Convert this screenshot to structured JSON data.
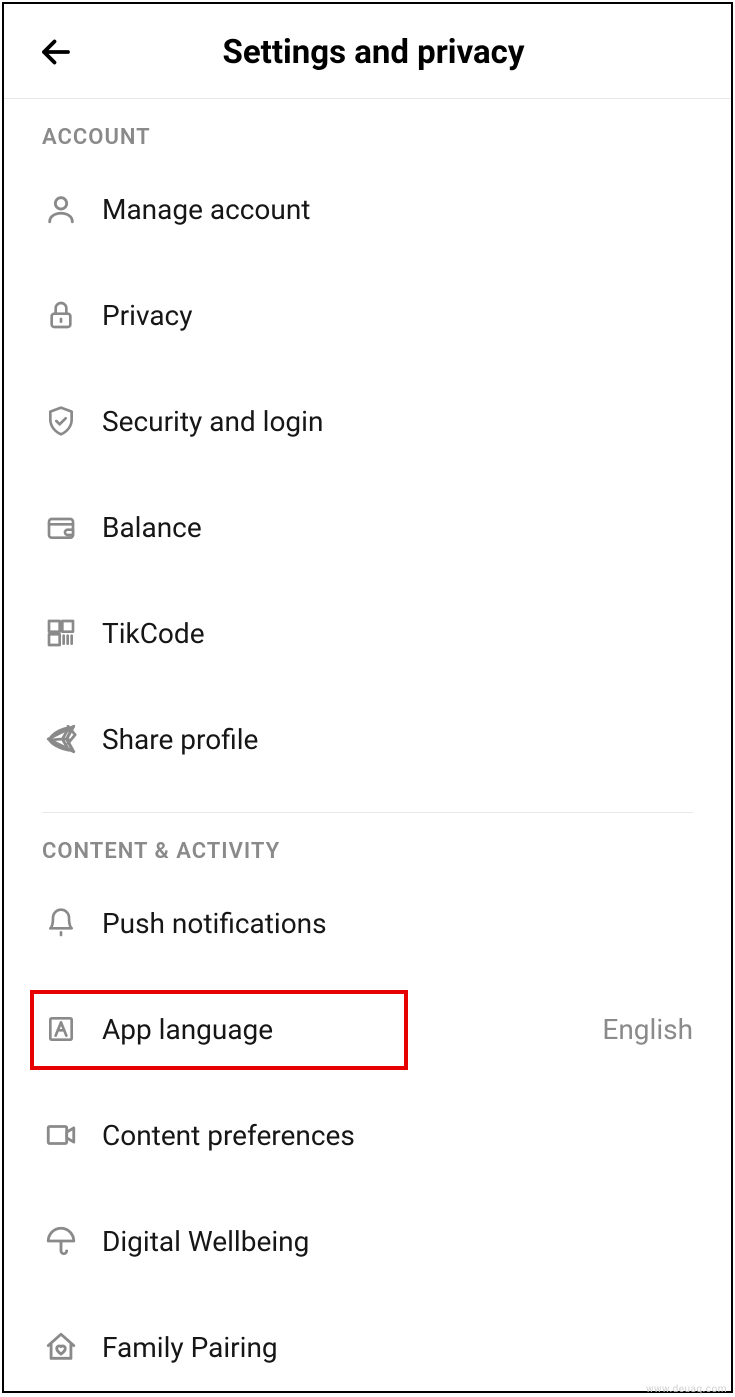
{
  "header": {
    "title": "Settings and privacy"
  },
  "sections": [
    {
      "label": "ACCOUNT",
      "items": [
        {
          "icon": "person-icon",
          "label": "Manage account"
        },
        {
          "icon": "lock-icon",
          "label": "Privacy"
        },
        {
          "icon": "shield-icon",
          "label": "Security and login"
        },
        {
          "icon": "wallet-icon",
          "label": "Balance"
        },
        {
          "icon": "qr-icon",
          "label": "TikCode"
        },
        {
          "icon": "share-icon",
          "label": "Share profile"
        }
      ]
    },
    {
      "label": "CONTENT & ACTIVITY",
      "items": [
        {
          "icon": "bell-icon",
          "label": "Push notifications"
        },
        {
          "icon": "language-icon",
          "label": "App language",
          "value": "English",
          "highlighted": true
        },
        {
          "icon": "video-icon",
          "label": "Content preferences"
        },
        {
          "icon": "umbrella-icon",
          "label": "Digital Wellbeing"
        },
        {
          "icon": "home-heart-icon",
          "label": "Family Pairing"
        }
      ]
    }
  ],
  "watermark": "www.deuaq.com"
}
